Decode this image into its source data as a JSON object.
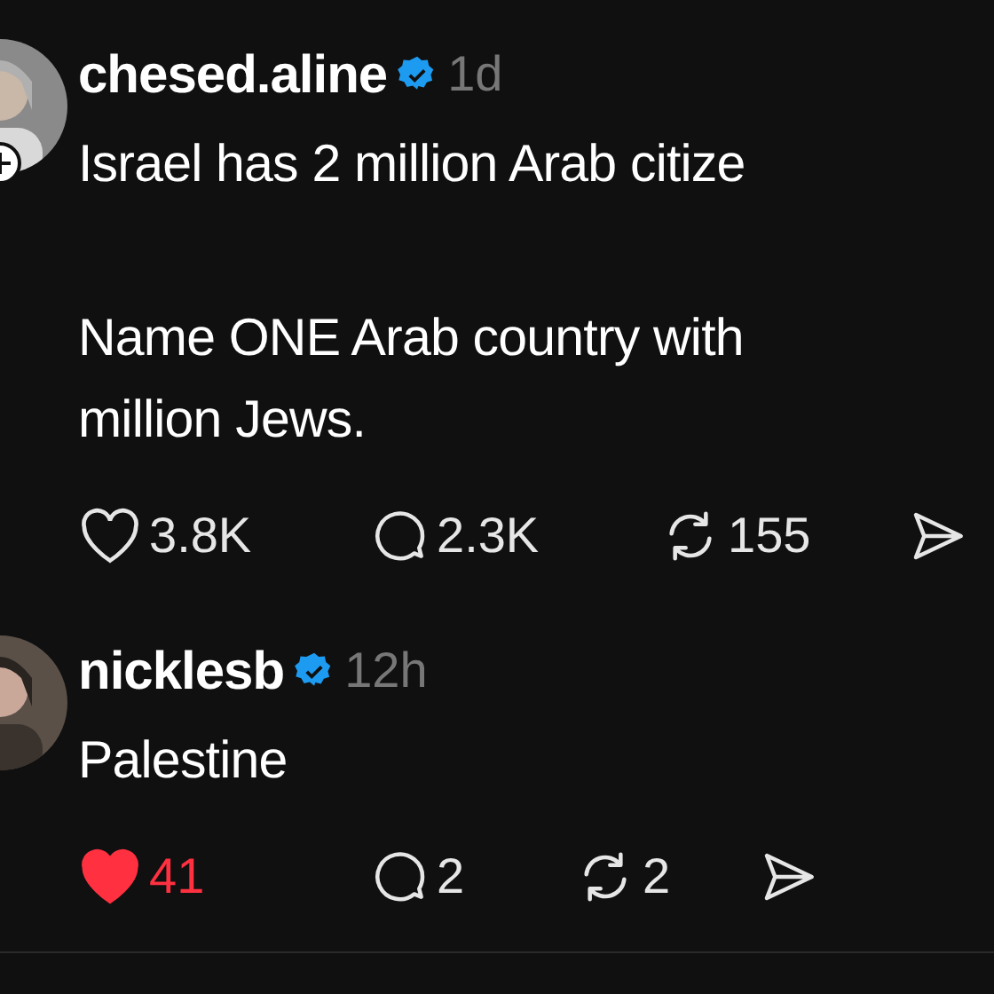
{
  "posts": [
    {
      "username": "chesed.aline",
      "verified": true,
      "time": "1d",
      "follow_badge": true,
      "paragraphs": [
        "Israel has 2 million Arab citize",
        "Name ONE Arab country with\nmillion Jews."
      ],
      "likes": {
        "count": "3.8K",
        "liked": false
      },
      "replies": "2.3K",
      "reposts": "155"
    },
    {
      "username": "nicklesb",
      "verified": true,
      "time": "12h",
      "follow_badge": false,
      "paragraphs": [
        "Palestine"
      ],
      "likes": {
        "count": "41",
        "liked": true
      },
      "replies": "2",
      "reposts": "2"
    }
  ]
}
